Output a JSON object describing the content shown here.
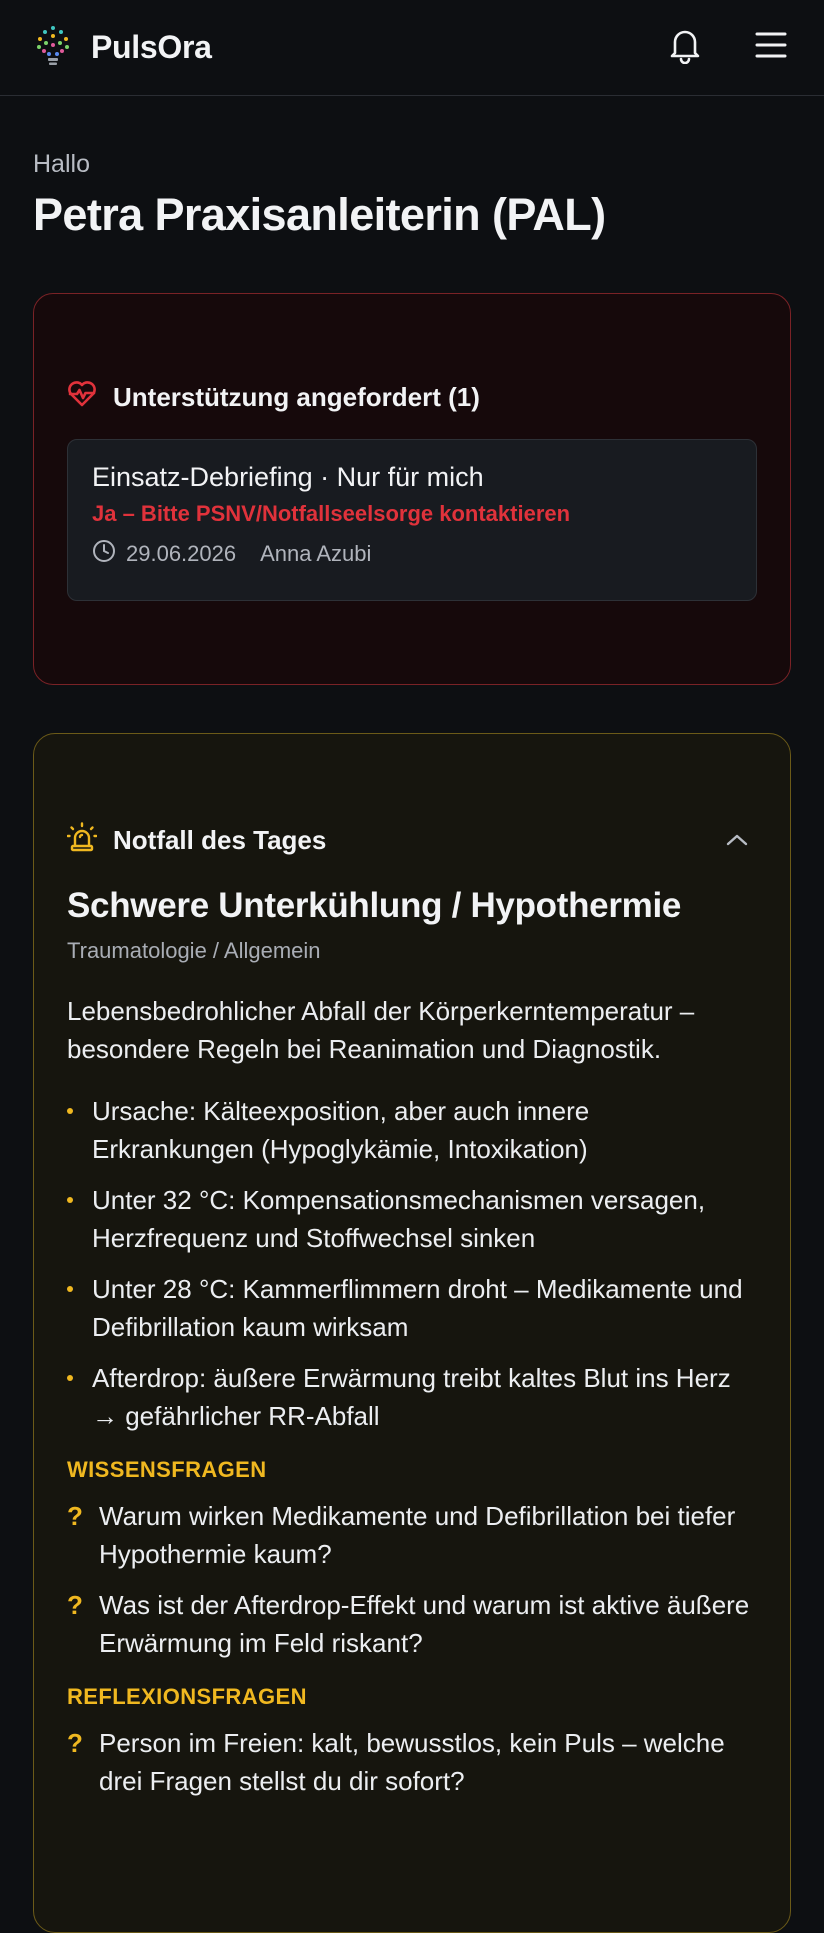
{
  "header": {
    "app_name": "PulsOra",
    "logo_icon": "lightbulb-network-icon",
    "notification_icon": "bell-icon",
    "menu_icon": "hamburger-menu-icon"
  },
  "greeting": {
    "hello": "Hallo",
    "user_name": "Petra Praxisanleiterin (PAL)"
  },
  "support": {
    "title": "Unterstützung angefordert (1)",
    "icon": "heart-pulse-icon",
    "accent": "#e0323b",
    "items": [
      {
        "title": "Einsatz-Debriefing · Nur für mich",
        "alert": "Ja – Bitte PSNV/Notfallseelsorge kontaktieren",
        "date": "29.06.2026",
        "author": "Anna Azubi"
      }
    ]
  },
  "emergency": {
    "section_title": "Notfall des Tages",
    "icon": "siren-icon",
    "accent": "#f0b820",
    "topic": "Schwere Unterkühlung / Hypothermie",
    "category": "Traumatologie / Allgemein",
    "lead": "Lebensbedrohlicher Abfall der Körperkerntemperatur – besondere Regeln bei Reanimation und Diagnostik.",
    "bullets": [
      "Ursache: Kälteexposition, aber auch innere Erkrankungen (Hypoglykämie, Intoxikation)",
      "Unter 32 °C: Kompensationsmechanismen versagen, Herzfrequenz und Stoffwechsel sinken",
      "Unter 28 °C: Kammerflimmern droht – Medikamente und Defibrillation kaum wirksam",
      "Afterdrop: äußere Erwärmung treibt kaltes Blut ins Herz → gefährlicher RR-Abfall"
    ],
    "knowledge_label": "WISSENSFRAGEN",
    "knowledge_questions": [
      "Warum wirken Medikamente und Defibrillation bei tiefer Hypothermie kaum?",
      "Was ist der Afterdrop-Effekt und warum ist aktive äußere Erwärmung im Feld riskant?"
    ],
    "reflection_label": "REFLEXIONSFRAGEN",
    "reflection_questions": [
      "Person im Freien: kalt, bewusstlos, kein Puls – welche drei Fragen stellst du dir sofort?"
    ]
  }
}
